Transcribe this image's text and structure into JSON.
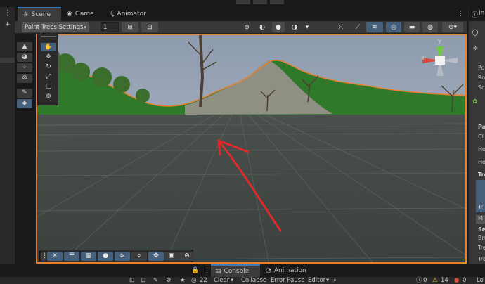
{
  "tabs": {
    "scene": "Scene",
    "game": "Game",
    "animator": "Animator",
    "inspector_partial": "In"
  },
  "toolbar": {
    "tool_dropdown": "Paint Trees Settings",
    "brush_value": "1",
    "dropdown_arrow": "▾"
  },
  "gizmo": {
    "x_label": "x",
    "y_label": "y"
  },
  "inspector": {
    "pos_label": "Po",
    "rot_label": "Ro",
    "scale_label": "Sc",
    "pa_label": "Pa",
    "cl_label": "Cl",
    "ho1_label": "Ho",
    "ho2_label": "Ho",
    "tre_label": "Tre",
    "tr_sub_label": "Tr",
    "m_label": "M",
    "se_label": "Se",
    "bru_label": "Bru",
    "tre2_label": "Tre",
    "tre3_label": "Tre",
    "lo_label": "Lo"
  },
  "bottom": {
    "console_tab": "Console",
    "animation_tab": "Animation",
    "hidden_count": "22",
    "clear": "Clear",
    "collapse": "Collapse",
    "error_pause": "Error Pause",
    "editor": "Editor",
    "errors_count": "0",
    "warnings_count": "14",
    "messages_count": "0"
  },
  "colors": {
    "selection_outline": "#e8802c",
    "annotation_arrow": "#e02a2a",
    "active_tab_accent": "#3a79bb",
    "toggle_active": "#46607c"
  }
}
